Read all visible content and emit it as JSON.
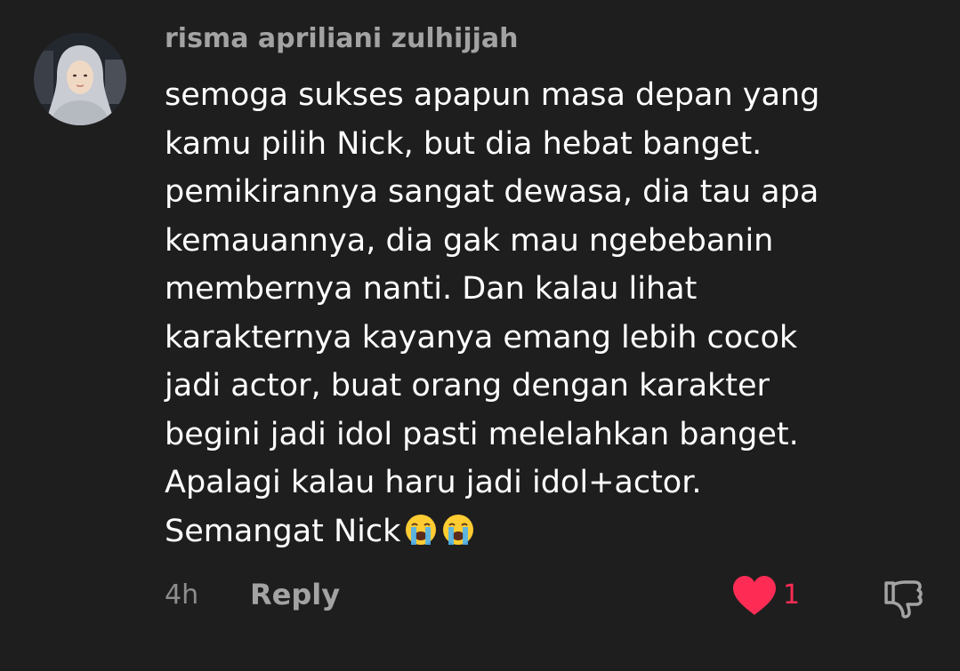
{
  "comment": {
    "username": "risma apriliani zulhijjah",
    "text": "semoga sukses apapun masa depan yang\nkamu pilih Nick, but dia hebat banget.\npemikirannya sangat dewasa, dia tau apa\nkemauannya, dia gak mau ngebebanin\nmembernya nanti. Dan kalau lihat\nkarakternya kayanya emang lebih cocok\njadi actor, buat orang dengan karakter\nbegini jadi idol pasti melelahkan banget.\nApalagi kalau haru jadi idol+actor.\nSemangat Nick",
    "emojis": [
      "crying-face-emoji",
      "crying-face-emoji"
    ],
    "time": "4h",
    "reply_label": "Reply",
    "like_count": "1",
    "liked": true
  },
  "colors": {
    "background": "#1e1e1e",
    "username": "#a3a3a3",
    "text": "#ffffff",
    "like": "#fe2c55",
    "muted": "#8d8d8d"
  },
  "icons": {
    "like": "heart-icon",
    "dislike": "thumbs-down-icon"
  }
}
